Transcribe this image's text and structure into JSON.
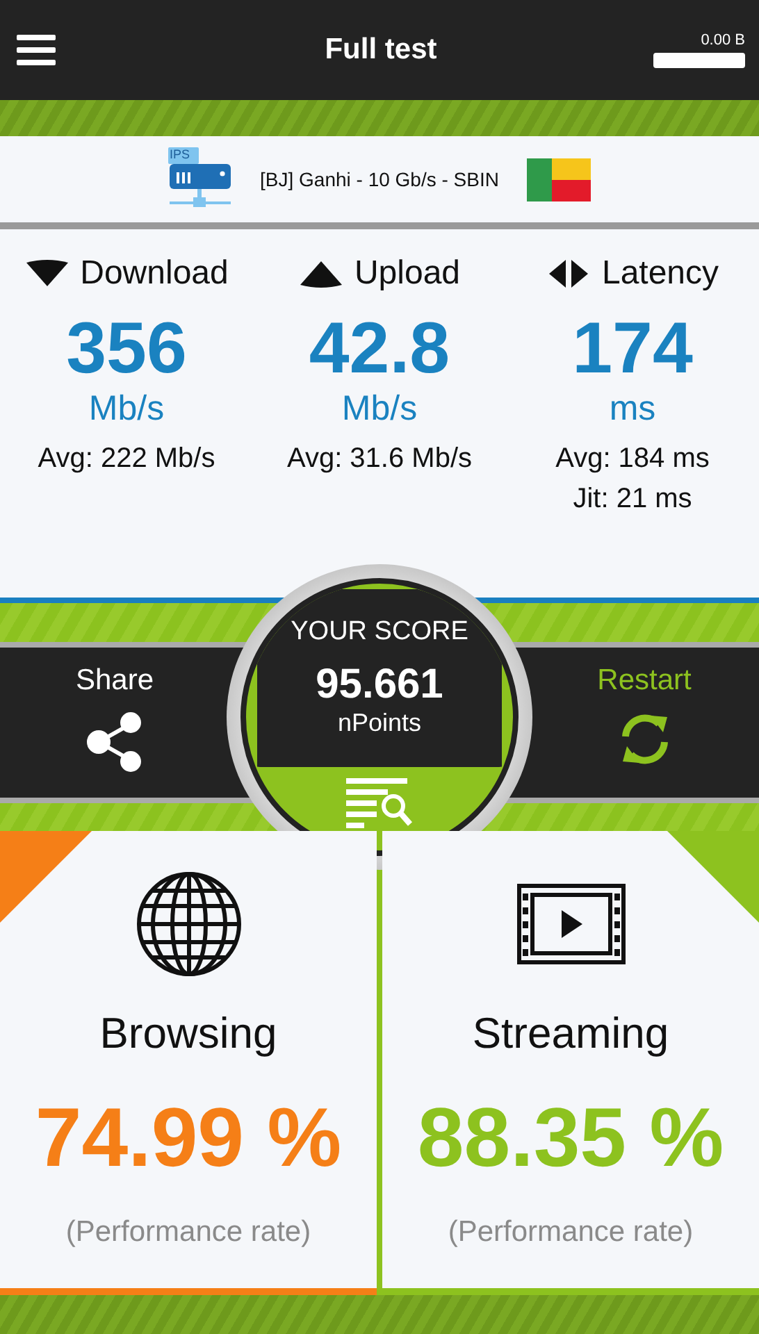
{
  "header": {
    "title": "Full test",
    "data_used": "0.00 B"
  },
  "server": {
    "badge": "IPS",
    "name": "[BJ] Ganhi - 10 Gb/s - SBIN"
  },
  "metrics": [
    {
      "kind": "download",
      "label": "Download",
      "value": "356",
      "unit": "Mb/s",
      "details": [
        "Avg: 222 Mb/s"
      ]
    },
    {
      "kind": "upload",
      "label": "Upload",
      "value": "42.8",
      "unit": "Mb/s",
      "details": [
        "Avg: 31.6 Mb/s"
      ]
    },
    {
      "kind": "latency",
      "label": "Latency",
      "value": "174",
      "unit": "ms",
      "details": [
        "Avg: 184 ms",
        "Jit: 21 ms"
      ]
    }
  ],
  "score": {
    "title": "YOUR SCORE",
    "value": "95.661",
    "unit": "nPoints"
  },
  "actions": [
    {
      "kind": "share",
      "label": "Share"
    },
    {
      "kind": "restart",
      "label": "Restart"
    }
  ],
  "cards": [
    {
      "kind": "browsing",
      "label": "Browsing",
      "value": "74.99 %",
      "caption": "(Performance rate)",
      "color": "#f57f17"
    },
    {
      "kind": "streaming",
      "label": "Streaming",
      "value": "88.35 %",
      "caption": "(Performance rate)",
      "color": "#8dc21f"
    }
  ]
}
